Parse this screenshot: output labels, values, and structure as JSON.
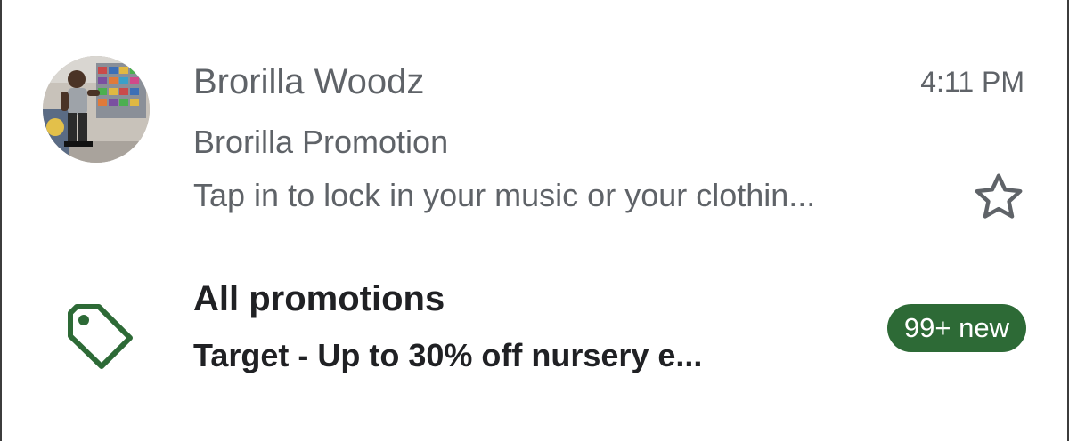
{
  "email": {
    "sender": "Brorilla Woodz",
    "time": "4:11 PM",
    "subject": "Brorilla Promotion",
    "snippet": "Tap in to lock in your music or your clothin...",
    "starred": false
  },
  "promotions": {
    "title": "All promotions",
    "snippet": "Target - Up to 30% off nursery e...",
    "badge": "99+ new"
  },
  "colors": {
    "badge_bg": "#2d6a36",
    "tag_icon": "#2d6a36",
    "secondary_text": "#5f6368",
    "primary_text": "#202124"
  },
  "icons": {
    "star": "star-outline-icon",
    "tag": "tag-icon"
  }
}
